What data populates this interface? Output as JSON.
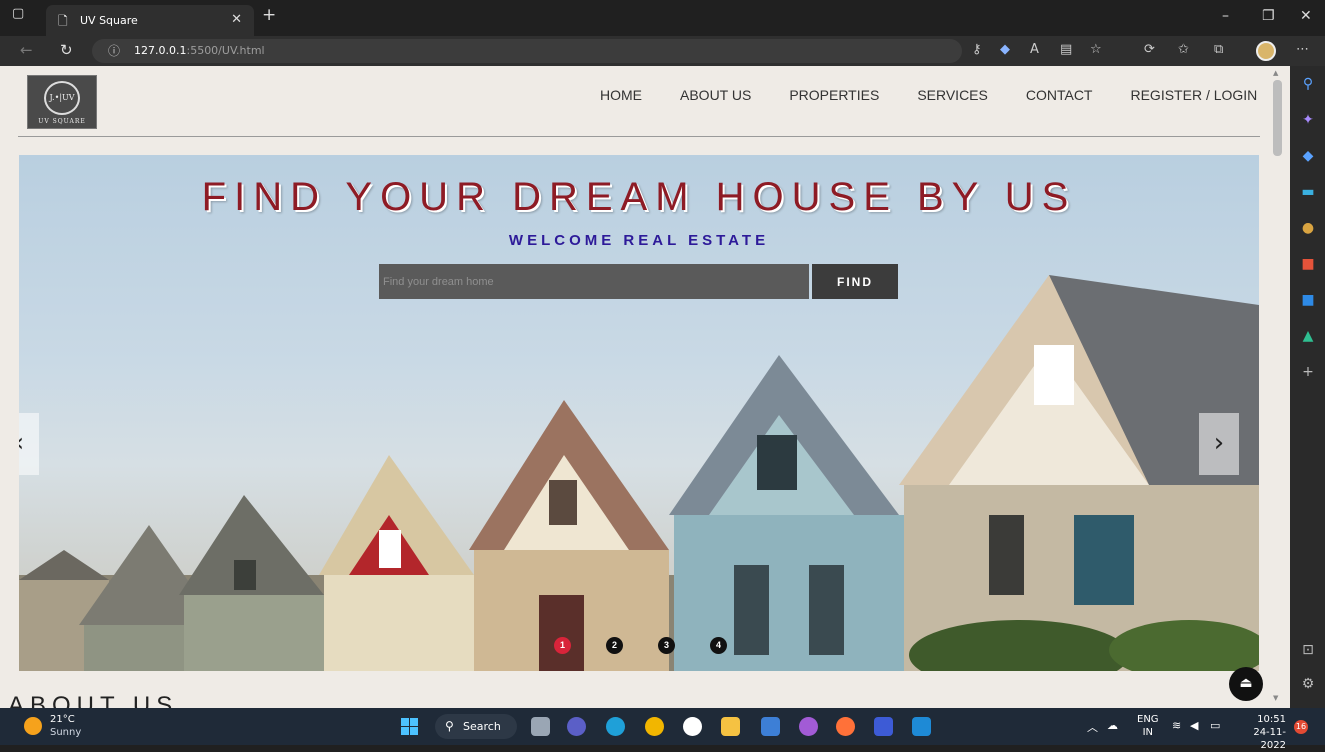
{
  "browser": {
    "tab_title": "UV Square",
    "url_host": "127.0.0.1",
    "url_rest": ":5500/UV.html"
  },
  "page": {
    "logo_text": "UV SQUARE",
    "logo_mark": "J.•|UV",
    "nav": [
      {
        "label": "HOME"
      },
      {
        "label": "ABOUT US"
      },
      {
        "label": "PROPERTIES"
      },
      {
        "label": "SERVICES"
      },
      {
        "label": "CONTACT"
      },
      {
        "label": "REGISTER / LOGIN"
      }
    ],
    "hero": {
      "title": "FIND YOUR DREAM HOUSE BY US",
      "subtitle": "WELCOME REAL ESTATE",
      "search_placeholder": "Find your dream home",
      "find_label": "FIND",
      "dots": [
        "1",
        "2",
        "3",
        "4"
      ],
      "active_dot": 1
    },
    "about_heading": "ABOUT US"
  },
  "taskbar": {
    "temp": "21°C",
    "condition": "Sunny",
    "search_label": "Search",
    "lang_top": "ENG",
    "lang_bottom": "IN",
    "time": "10:51",
    "date": "24-11-2022",
    "notifications": "16"
  },
  "colors": {
    "title": "#8e1b25",
    "subtitle": "#2d1a99",
    "active_dot": "#d8243a",
    "page_bg": "#efebe6"
  }
}
